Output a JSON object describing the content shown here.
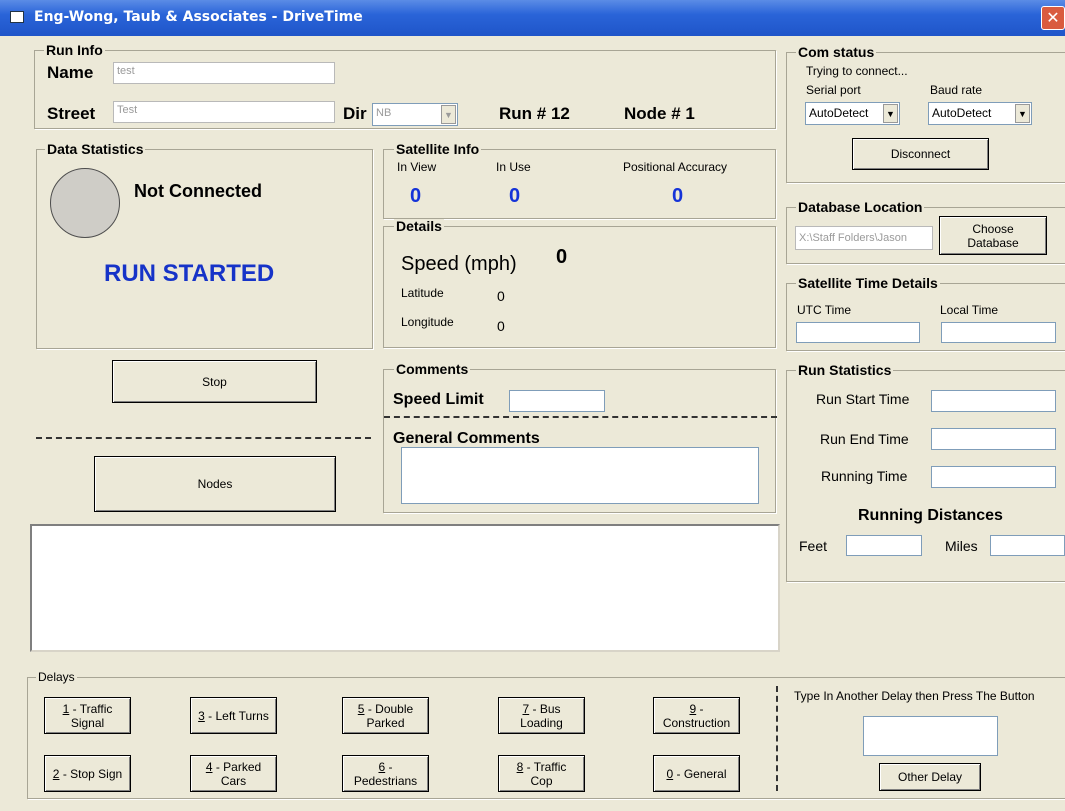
{
  "window": {
    "title": "Eng-Wong, Taub & Associates  -  DriveTime",
    "close": "✕"
  },
  "run_info": {
    "legend": "Run Info",
    "name_label": "Name",
    "name_value": "test",
    "street_label": "Street",
    "street_value": "Test",
    "dir_label": "Dir",
    "dir_value": "NB",
    "run_label": "Run # 12",
    "node_label": "Node #  1"
  },
  "com_status": {
    "legend": "Com status",
    "status": "Trying to connect...",
    "serial_label": "Serial port",
    "baud_label": "Baud rate",
    "serial_value": "AutoDetect",
    "baud_value": "AutoDetect",
    "disconnect": "Disconnect"
  },
  "data_stats": {
    "legend": "Data Statistics",
    "connection": "Not Connected",
    "run_state": "RUN STARTED"
  },
  "satellite": {
    "legend": "Satellite Info",
    "in_view_label": "In View",
    "in_use_label": "In Use",
    "accuracy_label": "Positional Accuracy",
    "in_view": "0",
    "in_use": "0",
    "accuracy": "0"
  },
  "details": {
    "legend": "Details",
    "speed_label": "Speed (mph)",
    "speed": "0",
    "lat_label": "Latitude",
    "lat": "0",
    "lon_label": "Longitude",
    "lon": "0"
  },
  "database": {
    "legend": "Database Location",
    "path": "X:\\Staff Folders\\Jason",
    "choose_line1": "Choose",
    "choose_line2": "Database"
  },
  "sat_time": {
    "legend": "Satellite Time Details",
    "utc_label": "UTC Time",
    "local_label": "Local Time"
  },
  "buttons": {
    "stop": "Stop",
    "nodes": "Nodes"
  },
  "comments": {
    "legend": "Comments",
    "speed_limit": "Speed Limit",
    "general": "General Comments"
  },
  "run_stats": {
    "legend": "Run Statistics",
    "start": "Run Start Time",
    "end": "Run End Time",
    "running": "Running Time",
    "distances": "Running Distances",
    "feet": "Feet",
    "miles": "Miles"
  },
  "delays": {
    "legend": "Delays",
    "other_prompt": "Type In Another Delay then Press The Button",
    "other_button": "Other Delay",
    "items": [
      {
        "key": "1",
        "l1": " - Traffic",
        "l2": "Signal"
      },
      {
        "key": "3",
        "l1": " - Left Turns",
        "l2": ""
      },
      {
        "key": "5",
        "l1": " - Double",
        "l2": "Parked"
      },
      {
        "key": "7",
        "l1": " - Bus",
        "l2": "Loading"
      },
      {
        "key": "9",
        "l1": " -",
        "l2": "Construction"
      },
      {
        "key": "2",
        "l1": " - Stop Sign",
        "l2": ""
      },
      {
        "key": "4",
        "l1": " - Parked",
        "l2": "Cars"
      },
      {
        "key": "6",
        "l1": " -",
        "l2": "Pedestrians"
      },
      {
        "key": "8",
        "l1": " - Traffic",
        "l2": "Cop"
      },
      {
        "key": "0",
        "l1": " - General",
        "l2": ""
      }
    ]
  }
}
